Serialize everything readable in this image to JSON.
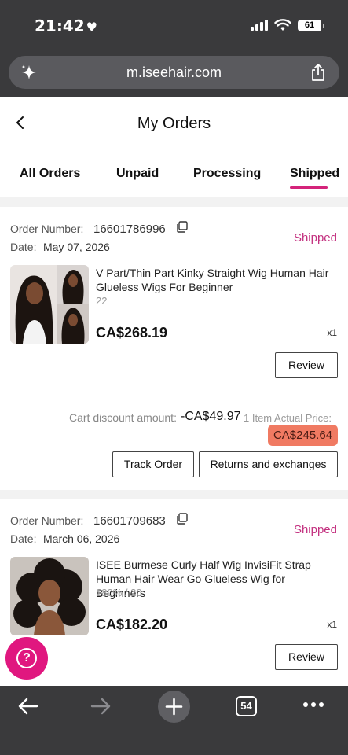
{
  "status_bar": {
    "time": "21:42",
    "heart": "♥",
    "battery": "61"
  },
  "browser": {
    "url": "m.iseehair.com"
  },
  "header": {
    "title": "My Orders"
  },
  "tabs": [
    {
      "label": "All Orders"
    },
    {
      "label": "Unpaid"
    },
    {
      "label": "Processing"
    },
    {
      "label": "Shipped",
      "active": true
    }
  ],
  "orders": [
    {
      "number_label": "Order Number:",
      "number": "16601786996",
      "date_label": "Date:",
      "date": "May 07, 2026",
      "status": "Shipped",
      "product_name": "V Part/Thin Part Kinky Straight Wig Human Hair Glueless Wigs For Beginner",
      "variant": "22",
      "price": "CA$268.19",
      "qty": "x1",
      "review_label": "Review",
      "discount_label": "Cart discount amount:",
      "discount": "-CA$49.97",
      "actual_price_label": "1 Item Actual Price:",
      "actual_price": "CA$245.64",
      "track_label": "Track Order",
      "returns_label": "Returns and exchanges"
    },
    {
      "number_label": "Order Number:",
      "number": "16601709683",
      "date_label": "Date:",
      "date": "March 06, 2026",
      "status": "Shipped",
      "product_name": "ISEE Burmese Curly Half Wig InvisiFit Strap Human Hair Wear Go Glueless Wig for Beginners",
      "variant": "180% / 20",
      "price": "CA$182.20",
      "qty": "x1",
      "review_label": "Review"
    }
  ],
  "toolbar": {
    "tab_count": "54"
  },
  "colors": {
    "accent": "#c3307f",
    "fab": "#e0177f",
    "highlight": "#f07a62",
    "chrome": "#3a3a3c"
  },
  "icons": [
    "heart-icon",
    "signal-icon",
    "wifi-icon",
    "battery-icon",
    "sparkle-icon",
    "share-icon",
    "back-chevron-icon",
    "copy-icon",
    "help-icon",
    "back-arrow-icon",
    "forward-arrow-icon",
    "plus-icon",
    "tabs-icon",
    "more-icon"
  ]
}
